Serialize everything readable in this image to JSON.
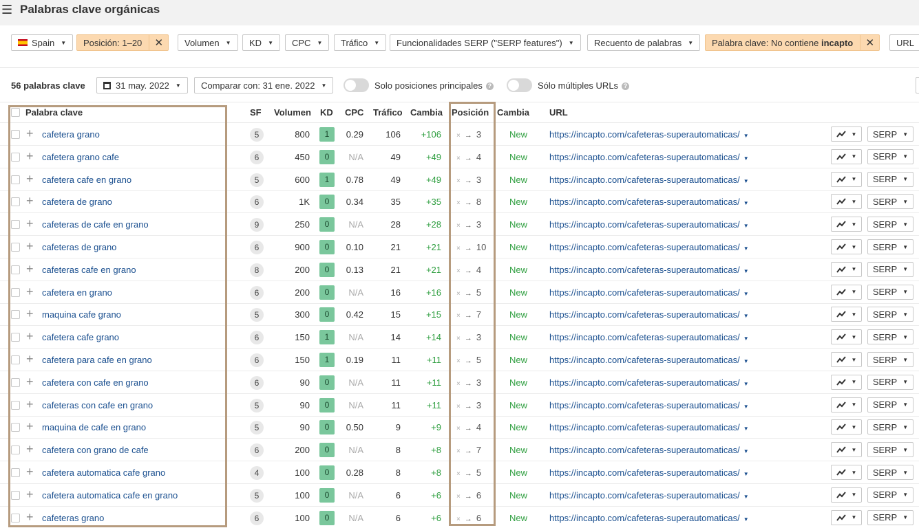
{
  "header": {
    "title": "Palabras clave orgánicas"
  },
  "filters": {
    "country": "Spain",
    "position": "Posición: 1–20",
    "volume": "Volumen",
    "kd": "KD",
    "cpc": "CPC",
    "traffic": "Tráfico",
    "serp_features": "Funcionalidades SERP (\"SERP features\")",
    "word_count": "Recuento de palabras",
    "keyword_filter_prefix": "Palabra clave: No contiene",
    "keyword_filter_term": "incapto",
    "url": "URL"
  },
  "toolbar": {
    "count": "56 palabras clave",
    "date": "31 may. 2022",
    "compare": "Comparar con: 31 ene. 2022",
    "toggle_top": "Solo posiciones principales",
    "toggle_urls": "Sólo múltiples URLs"
  },
  "columns": {
    "keyword": "Palabra clave",
    "sf": "SF",
    "volume": "Volumen",
    "kd": "KD",
    "cpc": "CPC",
    "traffic": "Tráfico",
    "change": "Cambia",
    "position": "Posición",
    "pos_change": "Cambia",
    "url": "URL"
  },
  "row_labels": {
    "pos_from": "×",
    "pos_arrow": "→",
    "serp": "SERP"
  },
  "rows": [
    {
      "kw": "cafetera grano",
      "sf": "5",
      "vol": "800",
      "kd": "1",
      "cpc": "0.29",
      "traffic": "106",
      "change": "+106",
      "pos": "3",
      "pchange": "New",
      "url": "https://incapto.com/cafeteras-superautomaticas/"
    },
    {
      "kw": "cafetera grano cafe",
      "sf": "6",
      "vol": "450",
      "kd": "0",
      "cpc": "N/A",
      "traffic": "49",
      "change": "+49",
      "pos": "4",
      "pchange": "New",
      "url": "https://incapto.com/cafeteras-superautomaticas/"
    },
    {
      "kw": "cafetera cafe en grano",
      "sf": "5",
      "vol": "600",
      "kd": "1",
      "cpc": "0.78",
      "traffic": "49",
      "change": "+49",
      "pos": "3",
      "pchange": "New",
      "url": "https://incapto.com/cafeteras-superautomaticas/"
    },
    {
      "kw": "cafetera de grano",
      "sf": "6",
      "vol": "1K",
      "kd": "0",
      "cpc": "0.34",
      "traffic": "35",
      "change": "+35",
      "pos": "8",
      "pchange": "New",
      "url": "https://incapto.com/cafeteras-superautomaticas/"
    },
    {
      "kw": "cafeteras de cafe en grano",
      "sf": "9",
      "vol": "250",
      "kd": "0",
      "cpc": "N/A",
      "traffic": "28",
      "change": "+28",
      "pos": "3",
      "pchange": "New",
      "url": "https://incapto.com/cafeteras-superautomaticas/"
    },
    {
      "kw": "cafeteras de grano",
      "sf": "6",
      "vol": "900",
      "kd": "0",
      "cpc": "0.10",
      "traffic": "21",
      "change": "+21",
      "pos": "10",
      "pchange": "New",
      "url": "https://incapto.com/cafeteras-superautomaticas/"
    },
    {
      "kw": "cafeteras cafe en grano",
      "sf": "8",
      "vol": "200",
      "kd": "0",
      "cpc": "0.13",
      "traffic": "21",
      "change": "+21",
      "pos": "4",
      "pchange": "New",
      "url": "https://incapto.com/cafeteras-superautomaticas/"
    },
    {
      "kw": "cafetera en grano",
      "sf": "6",
      "vol": "200",
      "kd": "0",
      "cpc": "N/A",
      "traffic": "16",
      "change": "+16",
      "pos": "5",
      "pchange": "New",
      "url": "https://incapto.com/cafeteras-superautomaticas/"
    },
    {
      "kw": "maquina cafe grano",
      "sf": "5",
      "vol": "300",
      "kd": "0",
      "cpc": "0.42",
      "traffic": "15",
      "change": "+15",
      "pos": "7",
      "pchange": "New",
      "url": "https://incapto.com/cafeteras-superautomaticas/"
    },
    {
      "kw": "cafetera cafe grano",
      "sf": "6",
      "vol": "150",
      "kd": "1",
      "cpc": "N/A",
      "traffic": "14",
      "change": "+14",
      "pos": "3",
      "pchange": "New",
      "url": "https://incapto.com/cafeteras-superautomaticas/"
    },
    {
      "kw": "cafetera para cafe en grano",
      "sf": "6",
      "vol": "150",
      "kd": "1",
      "cpc": "0.19",
      "traffic": "11",
      "change": "+11",
      "pos": "5",
      "pchange": "New",
      "url": "https://incapto.com/cafeteras-superautomaticas/"
    },
    {
      "kw": "cafetera con cafe en grano",
      "sf": "6",
      "vol": "90",
      "kd": "0",
      "cpc": "N/A",
      "traffic": "11",
      "change": "+11",
      "pos": "3",
      "pchange": "New",
      "url": "https://incapto.com/cafeteras-superautomaticas/"
    },
    {
      "kw": "cafeteras con cafe en grano",
      "sf": "5",
      "vol": "90",
      "kd": "0",
      "cpc": "N/A",
      "traffic": "11",
      "change": "+11",
      "pos": "3",
      "pchange": "New",
      "url": "https://incapto.com/cafeteras-superautomaticas/"
    },
    {
      "kw": "maquina de cafe en grano",
      "sf": "5",
      "vol": "90",
      "kd": "0",
      "cpc": "0.50",
      "traffic": "9",
      "change": "+9",
      "pos": "4",
      "pchange": "New",
      "url": "https://incapto.com/cafeteras-superautomaticas/"
    },
    {
      "kw": "cafetera con grano de cafe",
      "sf": "6",
      "vol": "200",
      "kd": "0",
      "cpc": "N/A",
      "traffic": "8",
      "change": "+8",
      "pos": "7",
      "pchange": "New",
      "url": "https://incapto.com/cafeteras-superautomaticas/"
    },
    {
      "kw": "cafetera automatica cafe grano",
      "sf": "4",
      "vol": "100",
      "kd": "0",
      "cpc": "0.28",
      "traffic": "8",
      "change": "+8",
      "pos": "5",
      "pchange": "New",
      "url": "https://incapto.com/cafeteras-superautomaticas/"
    },
    {
      "kw": "cafetera automatica cafe en grano",
      "sf": "5",
      "vol": "100",
      "kd": "0",
      "cpc": "N/A",
      "traffic": "6",
      "change": "+6",
      "pos": "6",
      "pchange": "New",
      "url": "https://incapto.com/cafeteras-superautomaticas/"
    },
    {
      "kw": "cafeteras grano",
      "sf": "6",
      "vol": "100",
      "kd": "0",
      "cpc": "N/A",
      "traffic": "6",
      "change": "+6",
      "pos": "6",
      "pchange": "New",
      "url": "https://incapto.com/cafeteras-superautomaticas/"
    }
  ],
  "colors": {
    "kd_badge": "#7ac79c",
    "positive": "#2e9e3f",
    "link": "#1a4f8f",
    "highlight_border": "#b69b7e",
    "active_filter": "#fcd9b0"
  },
  "icons": {
    "menu": "hamburger-icon",
    "calendar": "calendar-icon",
    "chart": "trend-chart-icon",
    "help": "help-icon",
    "close": "close-icon",
    "plus": "plus-icon"
  }
}
